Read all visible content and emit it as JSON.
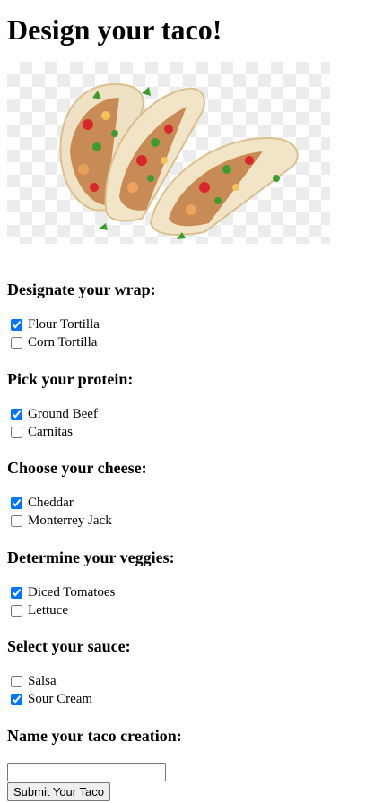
{
  "page": {
    "title": "Design your taco!",
    "image_alt": "taco image"
  },
  "sections": {
    "wrap": {
      "heading": "Designate your wrap:",
      "options": [
        {
          "label": "Flour Tortilla",
          "checked": true
        },
        {
          "label": "Corn Tortilla",
          "checked": false
        }
      ]
    },
    "protein": {
      "heading": "Pick your protein:",
      "options": [
        {
          "label": "Ground Beef",
          "checked": true
        },
        {
          "label": "Carnitas",
          "checked": false
        }
      ]
    },
    "cheese": {
      "heading": "Choose your cheese:",
      "options": [
        {
          "label": "Cheddar",
          "checked": true
        },
        {
          "label": "Monterrey Jack",
          "checked": false
        }
      ]
    },
    "veggies": {
      "heading": "Determine your veggies:",
      "options": [
        {
          "label": "Diced Tomatoes",
          "checked": true
        },
        {
          "label": "Lettuce",
          "checked": false
        }
      ]
    },
    "sauce": {
      "heading": "Select your sauce:",
      "options": [
        {
          "label": "Salsa",
          "checked": false
        },
        {
          "label": "Sour Cream",
          "checked": true
        }
      ]
    }
  },
  "name_section": {
    "heading": "Name your taco creation:",
    "input_value": "",
    "submit_label": "Submit Your Taco"
  }
}
